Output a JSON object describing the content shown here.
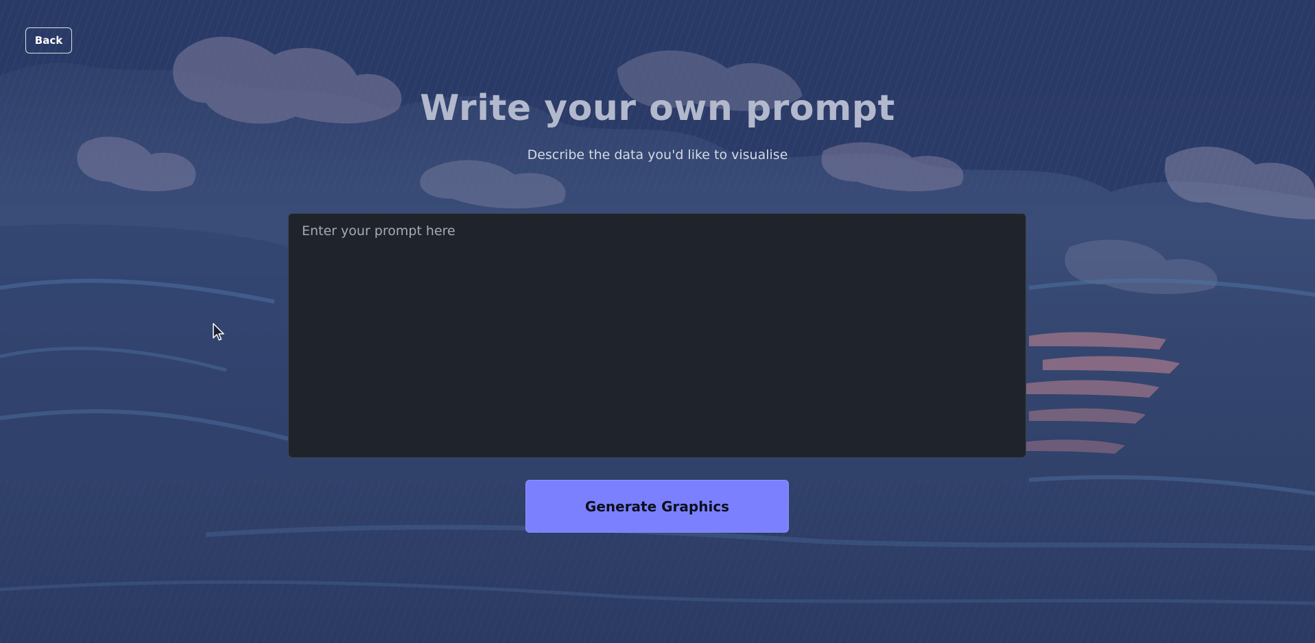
{
  "header": {
    "back_label": "Back",
    "title": "Write your own prompt",
    "subtitle": "Describe the data you'd like to visualise"
  },
  "prompt": {
    "value": "",
    "placeholder": "Enter your prompt here"
  },
  "actions": {
    "generate_label": "Generate Graphics"
  },
  "theme": {
    "background": "#2e3d66",
    "input_background": "#1f242c",
    "accent": "#7b80ff",
    "title_color": "#b3b9cc"
  },
  "icons": {
    "pointer": "mouse-pointer-icon"
  }
}
